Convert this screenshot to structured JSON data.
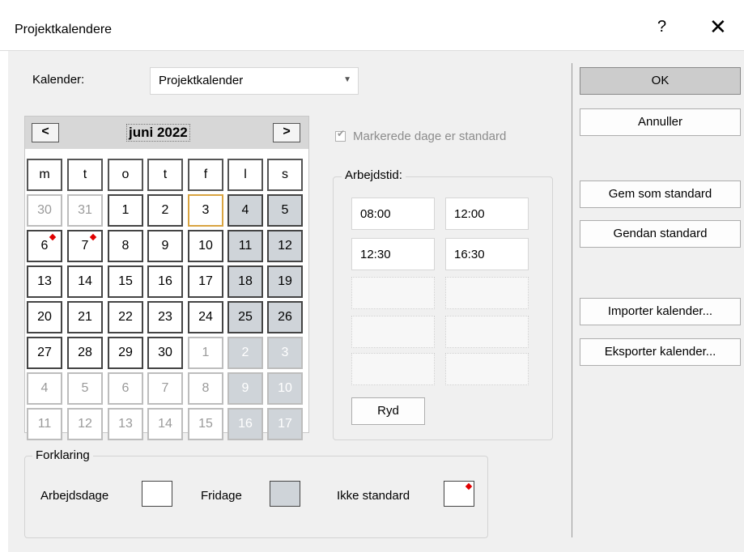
{
  "window": {
    "title": "Projektkalendere",
    "help": "?",
    "close": "✕"
  },
  "calendar_select": {
    "label": "Kalender:",
    "value": "Projektkalender"
  },
  "month_nav": {
    "prev": "<",
    "next": ">",
    "month": "juni 2022"
  },
  "weekdays": [
    "m",
    "t",
    "o",
    "t",
    "f",
    "l",
    "s"
  ],
  "days": [
    [
      "30",
      "31",
      "1",
      "2",
      "3",
      "4",
      "5"
    ],
    [
      "6",
      "7",
      "8",
      "9",
      "10",
      "11",
      "12"
    ],
    [
      "13",
      "14",
      "15",
      "16",
      "17",
      "18",
      "19"
    ],
    [
      "20",
      "21",
      "22",
      "23",
      "24",
      "25",
      "26"
    ],
    [
      "27",
      "28",
      "29",
      "30",
      "1",
      "2",
      "3"
    ],
    [
      "4",
      "5",
      "6",
      "7",
      "8",
      "9",
      "10"
    ],
    [
      "11",
      "12",
      "13",
      "14",
      "15",
      "16",
      "17"
    ]
  ],
  "checkbox": {
    "label": "Markerede dage er standard"
  },
  "worktime": {
    "legend": "Arbejdstid:",
    "slots": [
      [
        "08:00",
        "12:00"
      ],
      [
        "12:30",
        "16:30"
      ],
      [
        "",
        ""
      ],
      [
        "",
        ""
      ],
      [
        "",
        ""
      ]
    ],
    "clear": "Ryd"
  },
  "legend": {
    "title": "Forklaring",
    "workdays": "Arbejdsdage",
    "holidays": "Fridage",
    "nonstandard": "Ikke standard"
  },
  "buttons": {
    "ok": "OK",
    "cancel": "Annuller",
    "save_default": "Gem som standard",
    "restore_default": "Gendan standard",
    "import": "Importer kalender...",
    "export": "Eksporter kalender..."
  },
  "colors": {
    "weekend": "#cfd4d9",
    "today_border": "#d9a441",
    "marker": "#e00000"
  }
}
